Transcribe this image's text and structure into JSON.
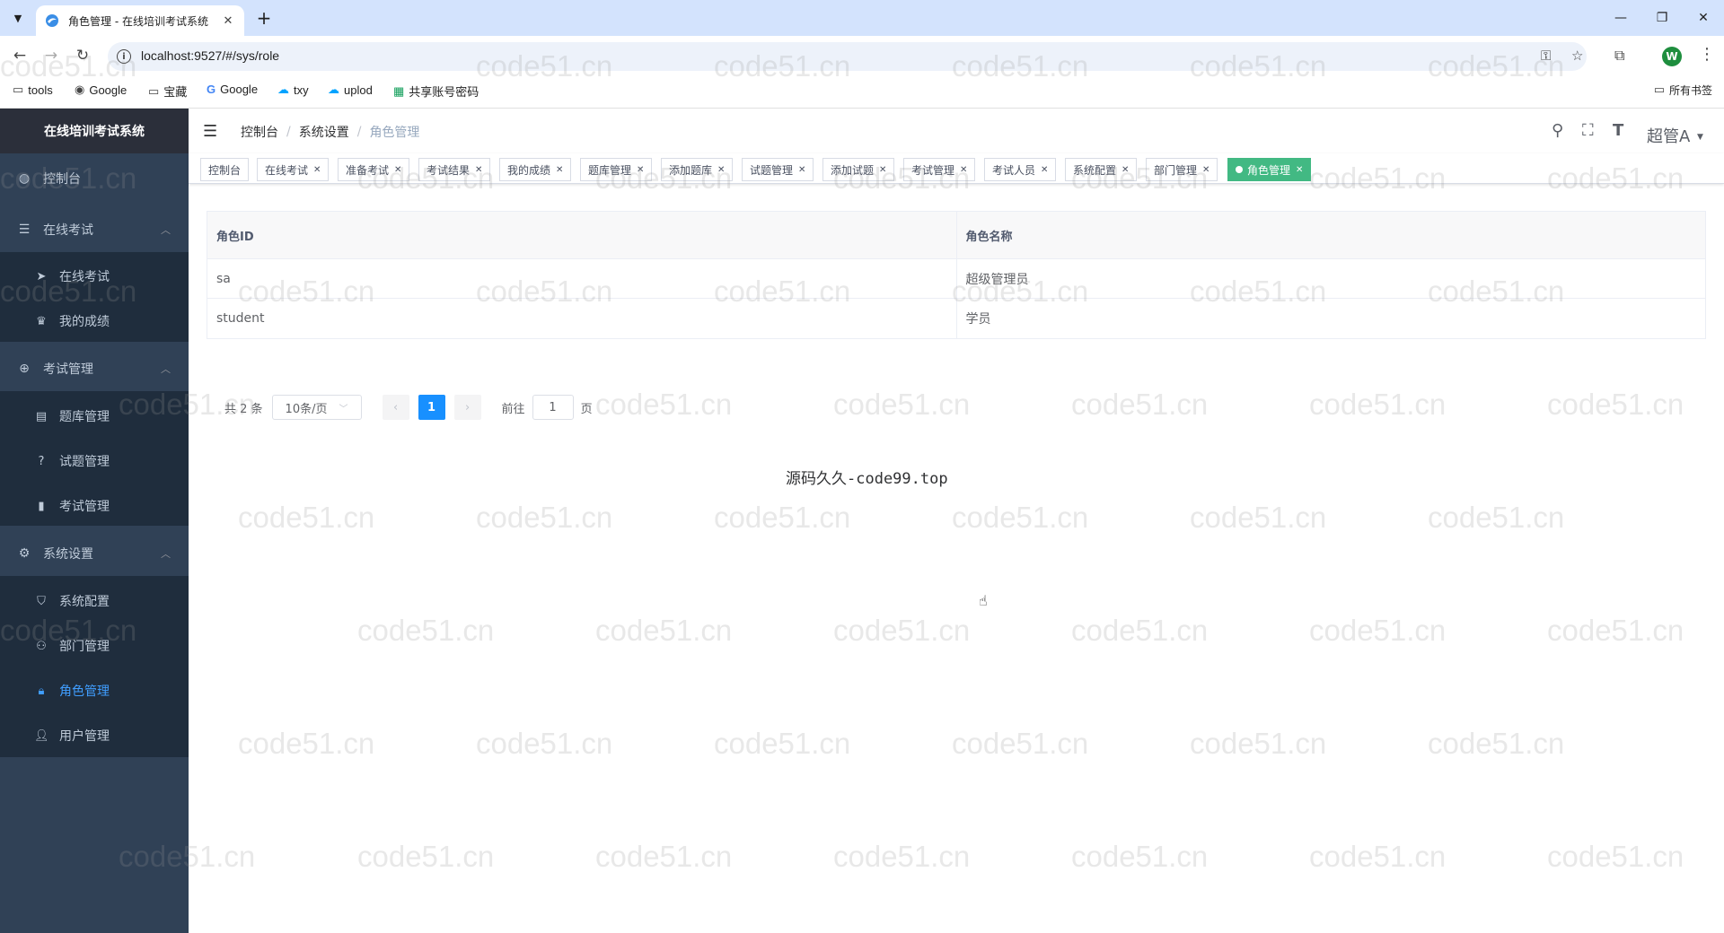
{
  "browser": {
    "tab_title": "角色管理 - 在线培训考试系统",
    "url": "localhost:9527/#/sys/role",
    "profile_initial": "W",
    "bookmarks": [
      "tools",
      "Google",
      "宝藏",
      "Google",
      "txy",
      "uplod",
      "共享账号密码"
    ],
    "all_bookmarks": "所有书签"
  },
  "sidebar": {
    "title": "在线培训考试系统",
    "dashboard": "控制台",
    "online_exam": {
      "label": "在线考试",
      "items": [
        "在线考试",
        "我的成绩"
      ]
    },
    "exam_manage": {
      "label": "考试管理",
      "items": [
        "题库管理",
        "试题管理",
        "考试管理"
      ]
    },
    "sys_settings": {
      "label": "系统设置",
      "items": [
        "系统配置",
        "部门管理",
        "角色管理",
        "用户管理"
      ]
    }
  },
  "navbar": {
    "breadcrumb": [
      "控制台",
      "系统设置",
      "角色管理"
    ],
    "user": "超管A"
  },
  "tags": [
    "控制台",
    "在线考试",
    "准备考试",
    "考试结果",
    "我的成绩",
    "题库管理",
    "添加题库",
    "试题管理",
    "添加试题",
    "考试管理",
    "考试人员",
    "系统配置",
    "部门管理",
    "角色管理"
  ],
  "table": {
    "headers": [
      "角色ID",
      "角色名称"
    ],
    "rows": [
      [
        "sa",
        "超级管理员"
      ],
      [
        "student",
        "学员"
      ]
    ]
  },
  "pagination": {
    "total": "共 2 条",
    "page_size": "10条/页",
    "current_page": "1",
    "goto_label": "前往",
    "goto_value": "1",
    "page_suffix": "页"
  },
  "footer": "源码久久-code99.top",
  "watermark": "code51.cn"
}
